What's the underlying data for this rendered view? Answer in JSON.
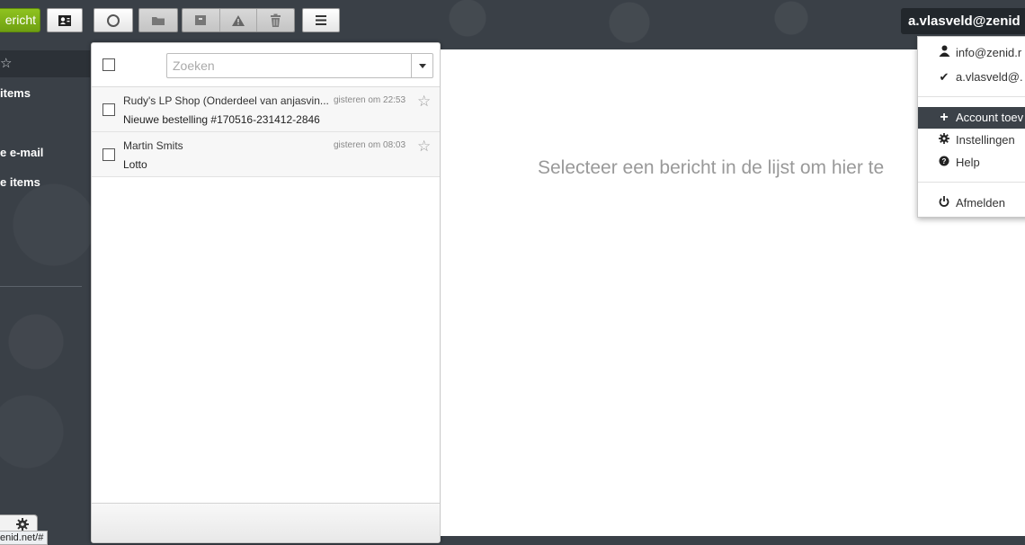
{
  "toolbar": {
    "new_message_label": "ericht",
    "buttons": [
      {
        "name": "contacts-icon"
      },
      {
        "name": "refresh-icon"
      },
      {
        "name": "folder-icon"
      },
      {
        "name": "archive-icon"
      },
      {
        "name": "spam-icon"
      },
      {
        "name": "trash-icon"
      },
      {
        "name": "menu-icon"
      }
    ]
  },
  "account": {
    "email_label": "a.vlasveld@zenid",
    "menu": {
      "identities": [
        {
          "label": "info@zenid.r",
          "icon": "user-icon"
        },
        {
          "label": "a.vlasveld@.",
          "icon": "check-icon"
        }
      ],
      "add_account": "Account toev",
      "settings": "Instellingen",
      "help": "Help",
      "logout": "Afmelden"
    }
  },
  "sidebar": {
    "items": [
      {
        "label": "",
        "icon": "star-icon"
      },
      {
        "label": "items"
      },
      {
        "label": "e e-mail"
      },
      {
        "label": "e items"
      }
    ],
    "status_url": "enid.net/#"
  },
  "message_list": {
    "search_placeholder": "Zoeken",
    "messages": [
      {
        "from": "Rudy's LP Shop (Onderdeel van anjasvin...",
        "date": "gisteren om 22:53",
        "subject": "Nieuwe bestelling #170516-231412-2846"
      },
      {
        "from": "Martin Smits",
        "date": "gisteren om 08:03",
        "subject": "Lotto"
      }
    ]
  },
  "reading_pane": {
    "empty_text": "Selecteer een bericht in de lijst om hier te"
  },
  "colors": {
    "accent_green": "#7fb419",
    "background": "#3a4047",
    "menu_highlight": "#3c4249"
  }
}
